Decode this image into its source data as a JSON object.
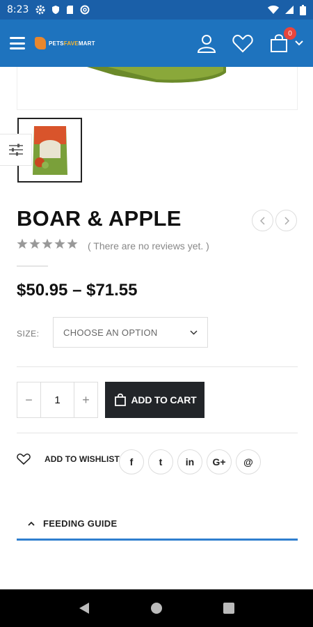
{
  "status_bar": {
    "time": "8:23"
  },
  "app_bar": {
    "logo_text_a": "PETS",
    "logo_text_b": "FAVE",
    "logo_text_c": "MART",
    "cart_count": "0"
  },
  "product": {
    "title": "BOAR & APPLE",
    "rating": 0,
    "reviews_text": "( There are no reviews yet. )",
    "price_range": "$50.95 – $71.55",
    "size_label": "SIZE:",
    "size_placeholder": "CHOOSE AN OPTION",
    "quantity": "1",
    "qty_minus": "−",
    "qty_plus": "+",
    "add_to_cart": "ADD TO CART",
    "wishlist_label": "ADD TO WISHLIST"
  },
  "share": [
    "f",
    "t",
    "in",
    "G+",
    "@"
  ],
  "tabs": [
    {
      "label": "FEEDING GUIDE",
      "expanded": true
    }
  ],
  "colors": {
    "brand_blue": "#1e73be",
    "status_blue": "#1a5fa8",
    "dark_button": "#222529",
    "badge_red": "#e8453c",
    "tab_underline": "#2f7fcf"
  }
}
